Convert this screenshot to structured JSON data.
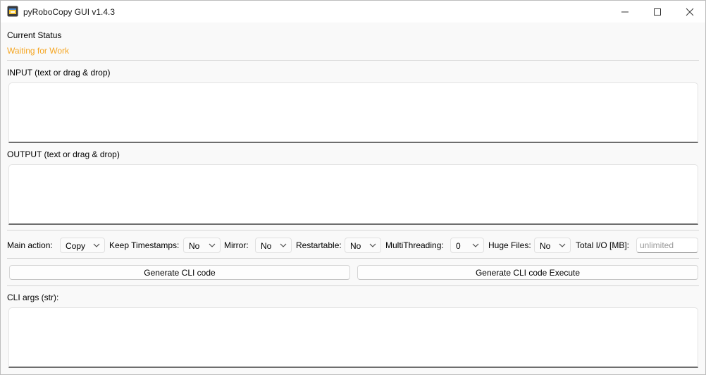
{
  "window": {
    "title": "pyRoboCopy GUI v1.4.3",
    "icons": {
      "app": "robocopy-app-icon",
      "minimize": "minimize-icon",
      "maximize": "maximize-icon",
      "close": "close-icon"
    }
  },
  "status": {
    "label": "Current Status",
    "value": "Waiting for Work",
    "value_color": "#f5a623"
  },
  "input": {
    "label": "INPUT (text or drag & drop)",
    "value": ""
  },
  "output": {
    "label": "OUTPUT (text or drag & drop)",
    "value": ""
  },
  "options": {
    "main_action": {
      "label": "Main action:",
      "value": "Copy"
    },
    "keep_timestamps": {
      "label": "Keep Timestamps:",
      "value": "No"
    },
    "mirror": {
      "label": "Mirror:",
      "value": "No"
    },
    "restartable": {
      "label": "Restartable:",
      "value": "No"
    },
    "multithreading": {
      "label": "MultiThreading:",
      "value": "0"
    },
    "huge_files": {
      "label": "Huge Files:",
      "value": "No"
    },
    "total_io": {
      "label": "Total I/O [MB]:",
      "placeholder": "unlimited"
    }
  },
  "buttons": {
    "generate": "Generate CLI code",
    "generate_execute": "Generate CLI code  Execute"
  },
  "cli_args": {
    "label": "CLI args (str):",
    "value": ""
  }
}
